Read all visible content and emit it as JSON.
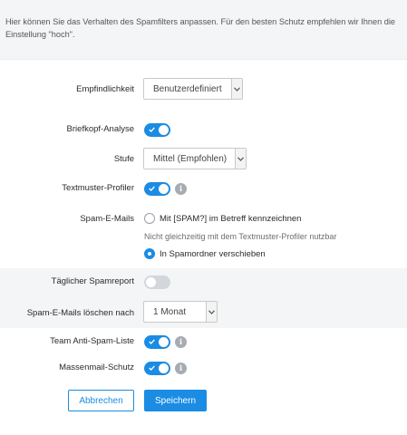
{
  "intro": {
    "text": "Hier können Sie das Verhalten des Spamfilters anpassen. Für den besten Schutz empfehlen wir Ihnen die Einstellung \"hoch\"."
  },
  "sensitivity": {
    "label": "Empfindlichkeit",
    "value": "Benutzerdefiniert"
  },
  "header_analysis": {
    "label": "Briefkopf-Analyse",
    "enabled": true
  },
  "level": {
    "label": "Stufe",
    "value": "Mittel (Empfohlen)"
  },
  "text_pattern": {
    "label": "Textmuster-Profiler",
    "enabled": true,
    "info": "i"
  },
  "spam_mails": {
    "label": "Spam-E-Mails",
    "option_tag": "Mit [SPAM?] im Betreff kennzeichnen",
    "option_tag_selected": false,
    "hint": "Nicht gleichzeitig mit dem Textmuster-Profiler nutzbar",
    "option_move": "In Spamordner verschieben",
    "option_move_selected": true
  },
  "daily_report": {
    "label": "Täglicher Spamreport",
    "enabled": false
  },
  "delete_after": {
    "label": "Spam-E-Mails löschen nach",
    "value": "1 Monat"
  },
  "team_antispam": {
    "label": "Team Anti-Spam-Liste",
    "enabled": true,
    "info": "i"
  },
  "mass_mail": {
    "label": "Massenmail-Schutz",
    "enabled": true,
    "info": "i"
  },
  "buttons": {
    "cancel": "Abbrechen",
    "save": "Speichern"
  },
  "colors": {
    "accent": "#1a8ce3",
    "toggle_off": "#d3d6db",
    "band": "#f4f5f7"
  }
}
